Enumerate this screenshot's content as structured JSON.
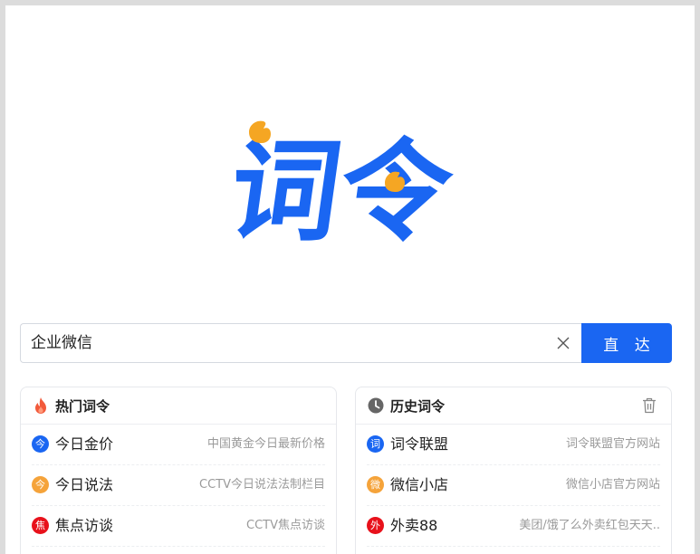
{
  "logo": {
    "text": "词令",
    "brand_color": "#1a66f2",
    "accent_color": "#f5a623"
  },
  "search": {
    "value": "企业微信",
    "button_label": "直 达",
    "clear_icon": "close-icon"
  },
  "hot": {
    "title": "热门词令",
    "icon": "flame-icon",
    "items": [
      {
        "badge": "今",
        "badge_color": "#1a66f2",
        "name": "今日金价",
        "desc": "中国黄金今日最新价格"
      },
      {
        "badge": "今",
        "badge_color": "#f5a33a",
        "name": "今日说法",
        "desc": "CCTV今日说法法制栏目"
      },
      {
        "badge": "焦",
        "badge_color": "#e8111b",
        "name": "焦点访谈",
        "desc": "CCTV焦点访谈"
      }
    ]
  },
  "history": {
    "title": "历史词令",
    "icon": "clock-icon",
    "clear_icon": "trash-icon",
    "items": [
      {
        "badge": "词",
        "badge_color": "#1a66f2",
        "name": "词令联盟",
        "desc": "词令联盟官方网站"
      },
      {
        "badge": "微",
        "badge_color": "#f5a33a",
        "name": "微信小店",
        "desc": "微信小店官方网站"
      },
      {
        "badge": "外",
        "badge_color": "#e8111b",
        "name": "外卖88",
        "desc": "美团/饿了么外卖红包天天.."
      }
    ]
  }
}
